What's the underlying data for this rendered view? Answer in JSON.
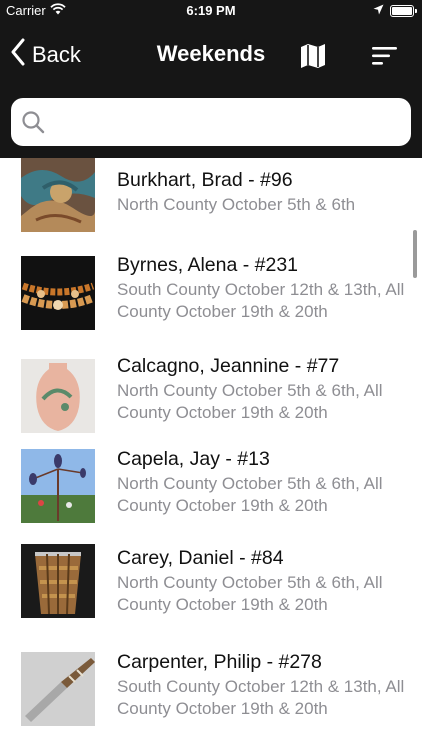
{
  "status_bar": {
    "carrier": "Carrier",
    "time": "6:19 PM"
  },
  "nav": {
    "back_label": "Back",
    "title": "Weekends"
  },
  "search": {
    "placeholder": "",
    "value": ""
  },
  "items": [
    {
      "name": "Burkhart, Brad - #96",
      "weekends": "North County October 5th & 6th",
      "image": "relief-sculpture"
    },
    {
      "name": "Byrnes, Alena - #231",
      "weekends": "South County October 12th & 13th, All County October 19th & 20th",
      "image": "beaded-necklace"
    },
    {
      "name": "Calcagno, Jeannine - #77",
      "weekends": "North County October 5th & 6th, All County October 19th & 20th",
      "image": "painted-vase"
    },
    {
      "name": "Capela, Jay - #13",
      "weekends": "North County October 5th & 6th, All County October 19th & 20th",
      "image": "kinetic-sculpture"
    },
    {
      "name": "Carey, Daniel - #84",
      "weekends": "North County October 5th & 6th, All County October 19th & 20th",
      "image": "wood-basket"
    },
    {
      "name": "Carpenter, Philip - #278",
      "weekends": "South County October 12th & 13th, All County October 19th & 20th",
      "image": "carved-knife"
    }
  ]
}
